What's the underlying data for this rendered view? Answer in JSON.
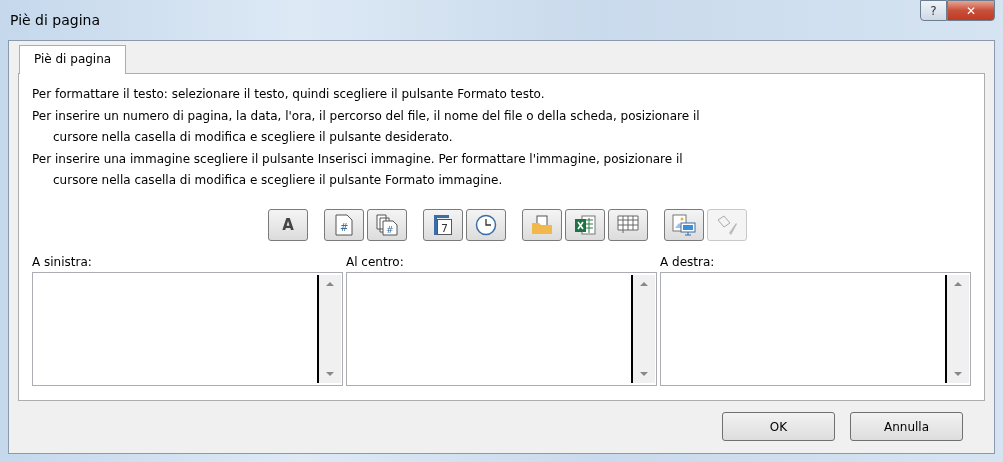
{
  "window": {
    "title": "Piè di pagina",
    "buttons": [
      "?",
      "✕"
    ]
  },
  "tabs": [
    {
      "label": "Piè di pagina",
      "selected": true
    }
  ],
  "instructions": [
    {
      "text": "Per formattare il testo: selezionare il testo, quindi scegliere il pulsante Formato testo.",
      "indented": false
    },
    {
      "text": "Per inserire un numero di pagina, la data, l'ora, il percorso del file, il nome del file o della scheda, posizionare il",
      "indented": false
    },
    {
      "text": "cursore nella casella di modifica e scegliere il pulsante desiderato.",
      "indented": true
    },
    {
      "text": "Per inserire una immagine scegliere il pulsante Inserisci immagine. Per formattare l'immagine, posizionare il",
      "indented": false
    },
    {
      "text": "cursore nella casella di modifica e scegliere il pulsante Formato immagine.",
      "indented": true
    }
  ],
  "toolbar": [
    [
      {
        "kind": "font",
        "label": "A",
        "disabled": false
      }
    ],
    [
      {
        "kind": "page",
        "label": "#",
        "disabled": false
      },
      {
        "kind": "pages",
        "label": "#",
        "disabled": false
      }
    ],
    [
      {
        "kind": "date",
        "label": "7",
        "disabled": false
      },
      {
        "kind": "time",
        "disabled": false
      }
    ],
    [
      {
        "kind": "path",
        "disabled": false
      },
      {
        "kind": "file",
        "disabled": false
      },
      {
        "kind": "sheet",
        "disabled": false
      }
    ],
    [
      {
        "kind": "picture",
        "disabled": false
      },
      {
        "kind": "format",
        "disabled": true
      }
    ]
  ],
  "sections": [
    {
      "label": "A sinistra:"
    },
    {
      "label": "Al centro:"
    },
    {
      "label": "A destra:"
    }
  ],
  "buttons": [
    "OK",
    "Annulla"
  ]
}
